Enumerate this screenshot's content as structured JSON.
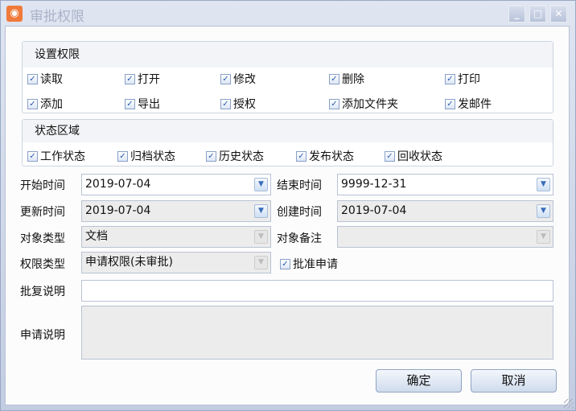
{
  "window": {
    "title": "审批权限"
  },
  "permissions": {
    "header": "设置权限",
    "items": [
      "读取",
      "打开",
      "修改",
      "删除",
      "打印",
      "添加",
      "导出",
      "授权",
      "添加文件夹",
      "发邮件"
    ]
  },
  "states": {
    "header": "状态区域",
    "items": [
      "工作状态",
      "归档状态",
      "历史状态",
      "发布状态",
      "回收状态"
    ]
  },
  "form": {
    "start_label": "开始时间",
    "start_value": "2019-07-04",
    "end_label": "结束时间",
    "end_value": "9999-12-31",
    "update_label": "更新时间",
    "update_value": "2019-07-04",
    "create_label": "创建时间",
    "create_value": "2019-07-04",
    "objtype_label": "对象类型",
    "objtype_value": "文档",
    "objnote_label": "对象备注",
    "objnote_value": "",
    "permtype_label": "权限类型",
    "permtype_value": "申请权限(未审批)",
    "approve_label": "批准申请",
    "reply_label": "批复说明",
    "reply_value": "",
    "apply_label": "申请说明",
    "apply_value": ""
  },
  "buttons": {
    "ok": "确定",
    "cancel": "取消"
  }
}
